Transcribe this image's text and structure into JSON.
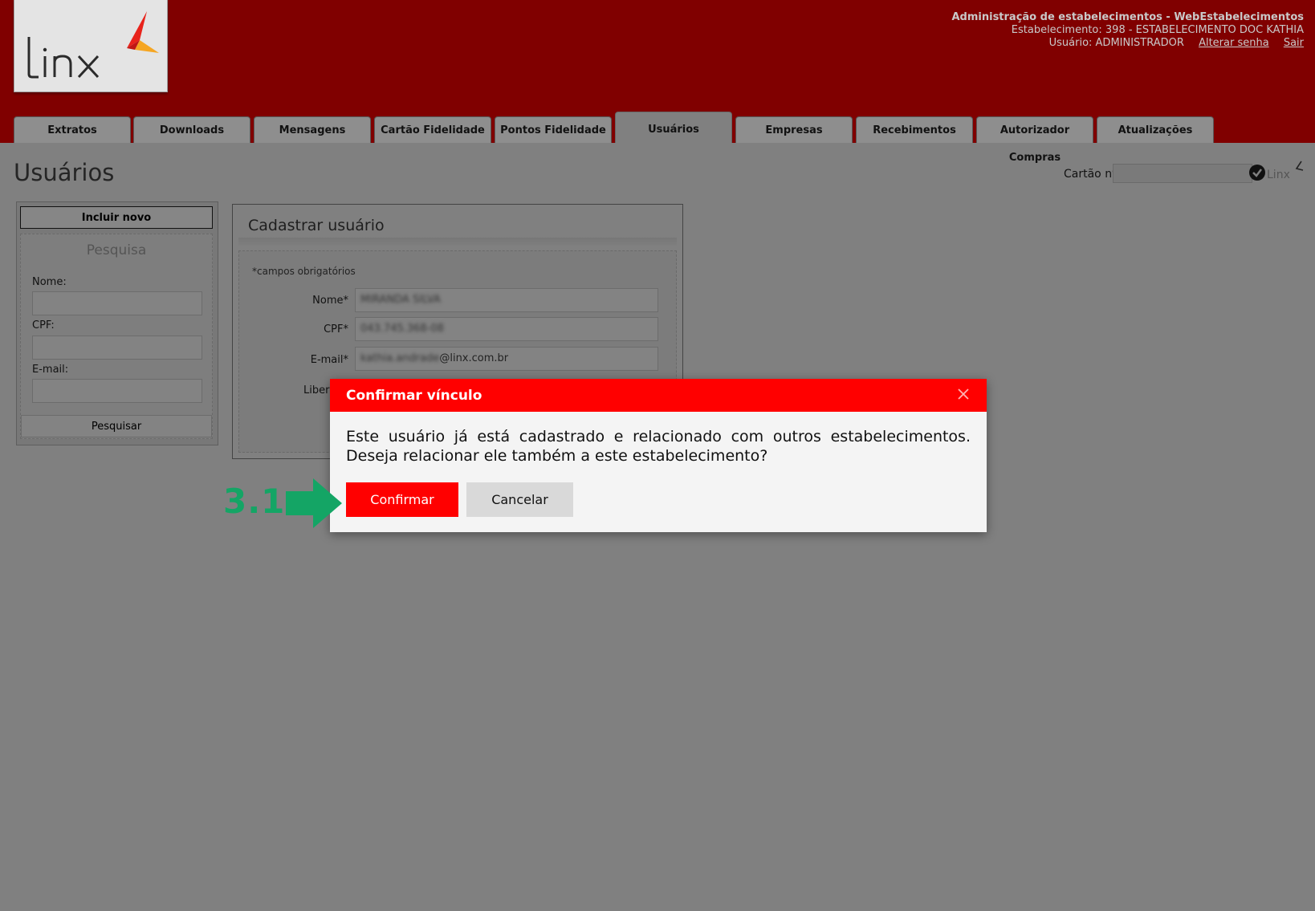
{
  "header": {
    "logo_text": "Linx",
    "app_title": "Administração de estabelecimentos - WebEstabelecimentos",
    "estabelecimento": "Estabelecimento: 398 - ESTABELECIMENTO DOC KATHIA",
    "usuario": "Usuário: ADMINISTRADOR",
    "alterar_senha": "Alterar senha",
    "sair": "Sair",
    "brand_color": "#800000"
  },
  "tabs": [
    {
      "label": "Extratos"
    },
    {
      "label": "Downloads"
    },
    {
      "label": "Mensagens"
    },
    {
      "label": "Cartão Fidelidade"
    },
    {
      "label": "Pontos Fidelidade"
    },
    {
      "label": "Usuários",
      "active": true
    },
    {
      "label": "Empresas"
    },
    {
      "label": "Recebimentos"
    },
    {
      "label": "Autorizador Compras"
    },
    {
      "label": "Atualizações"
    }
  ],
  "page": {
    "title": "Usuários",
    "cartao_label": "Cartão nº",
    "cartao_value": "",
    "brand_small": "Linx"
  },
  "sidebar": {
    "incluir_novo": "Incluir novo",
    "search_title": "Pesquisa",
    "nome_label": "Nome:",
    "cpf_label": "CPF:",
    "email_label": "E-mail:",
    "nome_value": "",
    "cpf_value": "",
    "email_value": "",
    "pesquisar": "Pesquisar"
  },
  "form": {
    "title": "Cadastrar usuário",
    "required_note": "*campos obrigatórios",
    "nome_label": "Nome*",
    "nome_value": "MIRANDA SILVA",
    "cpf_label": "CPF*",
    "cpf_value": "043.745.368-08",
    "email_label": "E-mail*",
    "email_prefix": "kathia.andrade",
    "email_suffix": "@linx.com.br",
    "liberar_label_partial": "Libera"
  },
  "modal": {
    "title": "Confirmar vínculo",
    "message": "Este usuário já está cadastrado e relacionado com outros estabelecimentos. Deseja relacionar ele também a este estabelecimento?",
    "confirm": "Confirmar",
    "cancel": "Cancelar",
    "accent": "#ff0000"
  },
  "annotation": {
    "step": "3.1.",
    "color": "#14a565"
  }
}
